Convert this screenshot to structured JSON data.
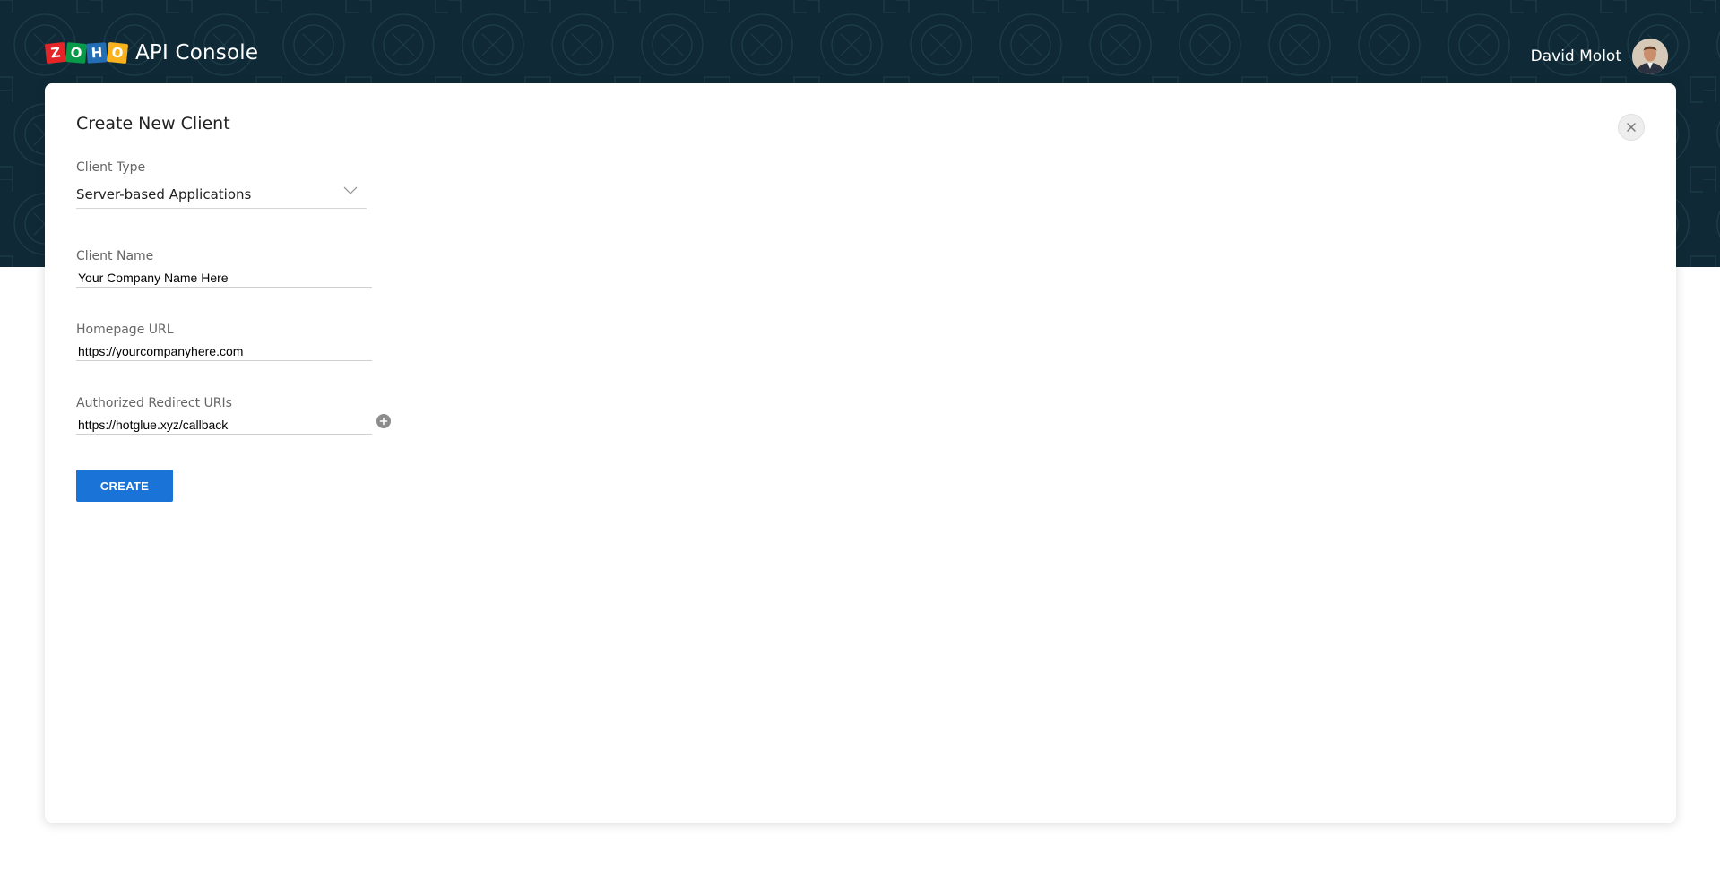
{
  "colors": {
    "header_bg": "#0f2a36",
    "primary": "#1a73d6",
    "logo_tiles": [
      "#e42527",
      "#089949",
      "#226db4",
      "#f9b21d"
    ]
  },
  "header": {
    "logo_letters": [
      "Z",
      "O",
      "H",
      "O"
    ],
    "product_name": "API Console",
    "user_name": "David Molot"
  },
  "dialog": {
    "title": "Create New Client",
    "close_icon": "close-icon",
    "client_type": {
      "label": "Client Type",
      "value": "Server-based Applications"
    },
    "client_name": {
      "label": "Client Name",
      "value": "Your Company Name Here"
    },
    "homepage_url": {
      "label": "Homepage URL",
      "value": "https://yourcompanyhere.com"
    },
    "redirect_uris": {
      "label": "Authorized Redirect URIs",
      "value": "https://hotglue.xyz/callback",
      "add_icon": "plus-circle-icon"
    },
    "create_label": "CREATE"
  }
}
